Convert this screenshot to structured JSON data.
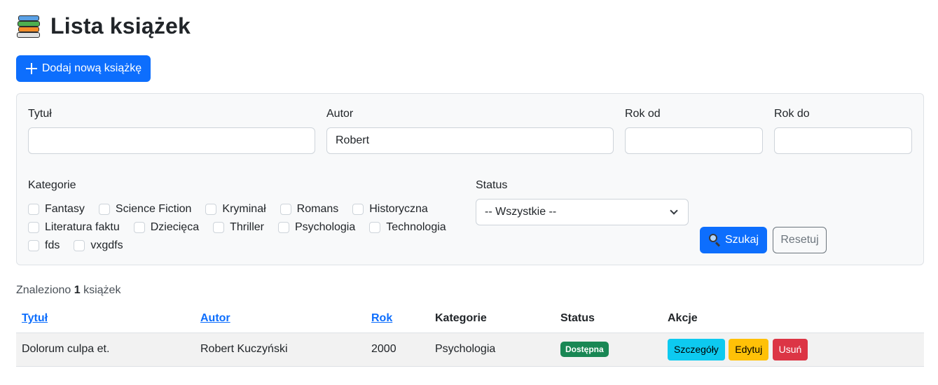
{
  "header": {
    "title": "Lista książek",
    "icon": "books-icon"
  },
  "add_button": {
    "label": "Dodaj nową książkę",
    "icon": "plus-icon"
  },
  "filters": {
    "title_label": "Tytuł",
    "title_value": "",
    "author_label": "Autor",
    "author_value": "Robert",
    "year_from_label": "Rok od",
    "year_from_value": "",
    "year_to_label": "Rok do",
    "year_to_value": "",
    "categories_label": "Kategorie",
    "categories": [
      [
        "Fantasy",
        "Science Fiction",
        "Kryminał",
        "Romans",
        "Historyczna"
      ],
      [
        "Literatura faktu",
        "Dziecięca",
        "Thriller",
        "Psychologia",
        "Technologia"
      ],
      [
        "fds",
        "vxgdfs"
      ]
    ],
    "status_label": "Status",
    "status_selected": "-- Wszystkie --",
    "search_label": "Szukaj",
    "reset_label": "Resetuj"
  },
  "results": {
    "prefix": "Znaleziono",
    "count": "1",
    "suffix": "książek"
  },
  "table": {
    "headers": {
      "title": "Tytuł",
      "author": "Autor",
      "year": "Rok",
      "categories": "Kategorie",
      "status": "Status",
      "actions": "Akcje"
    },
    "rows": [
      {
        "title": "Dolorum culpa et.",
        "author": "Robert Kuczyński",
        "year": "2000",
        "category": "Psychologia",
        "status": "Dostępna",
        "actions": {
          "details": "Szczegóły",
          "edit": "Edytuj",
          "delete": "Usuń"
        }
      }
    ]
  },
  "colors": {
    "primary": "#0d6efd",
    "success": "#198754",
    "info": "#0dcaf0",
    "warning": "#ffc107",
    "danger": "#dc3545",
    "secondary": "#6c757d"
  }
}
